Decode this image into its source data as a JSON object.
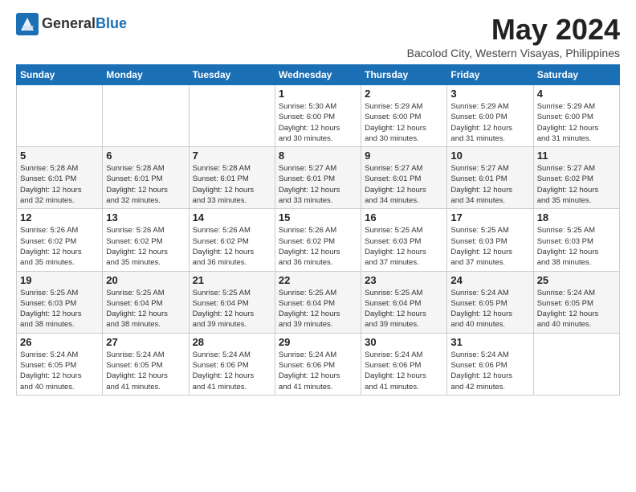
{
  "logo": {
    "general": "General",
    "blue": "Blue"
  },
  "title": "May 2024",
  "subtitle": "Bacolod City, Western Visayas, Philippines",
  "weekdays": [
    "Sunday",
    "Monday",
    "Tuesday",
    "Wednesday",
    "Thursday",
    "Friday",
    "Saturday"
  ],
  "weeks": [
    [
      {
        "day": "",
        "info": ""
      },
      {
        "day": "",
        "info": ""
      },
      {
        "day": "",
        "info": ""
      },
      {
        "day": "1",
        "info": "Sunrise: 5:30 AM\nSunset: 6:00 PM\nDaylight: 12 hours\nand 30 minutes."
      },
      {
        "day": "2",
        "info": "Sunrise: 5:29 AM\nSunset: 6:00 PM\nDaylight: 12 hours\nand 30 minutes."
      },
      {
        "day": "3",
        "info": "Sunrise: 5:29 AM\nSunset: 6:00 PM\nDaylight: 12 hours\nand 31 minutes."
      },
      {
        "day": "4",
        "info": "Sunrise: 5:29 AM\nSunset: 6:00 PM\nDaylight: 12 hours\nand 31 minutes."
      }
    ],
    [
      {
        "day": "5",
        "info": "Sunrise: 5:28 AM\nSunset: 6:01 PM\nDaylight: 12 hours\nand 32 minutes."
      },
      {
        "day": "6",
        "info": "Sunrise: 5:28 AM\nSunset: 6:01 PM\nDaylight: 12 hours\nand 32 minutes."
      },
      {
        "day": "7",
        "info": "Sunrise: 5:28 AM\nSunset: 6:01 PM\nDaylight: 12 hours\nand 33 minutes."
      },
      {
        "day": "8",
        "info": "Sunrise: 5:27 AM\nSunset: 6:01 PM\nDaylight: 12 hours\nand 33 minutes."
      },
      {
        "day": "9",
        "info": "Sunrise: 5:27 AM\nSunset: 6:01 PM\nDaylight: 12 hours\nand 34 minutes."
      },
      {
        "day": "10",
        "info": "Sunrise: 5:27 AM\nSunset: 6:01 PM\nDaylight: 12 hours\nand 34 minutes."
      },
      {
        "day": "11",
        "info": "Sunrise: 5:27 AM\nSunset: 6:02 PM\nDaylight: 12 hours\nand 35 minutes."
      }
    ],
    [
      {
        "day": "12",
        "info": "Sunrise: 5:26 AM\nSunset: 6:02 PM\nDaylight: 12 hours\nand 35 minutes."
      },
      {
        "day": "13",
        "info": "Sunrise: 5:26 AM\nSunset: 6:02 PM\nDaylight: 12 hours\nand 35 minutes."
      },
      {
        "day": "14",
        "info": "Sunrise: 5:26 AM\nSunset: 6:02 PM\nDaylight: 12 hours\nand 36 minutes."
      },
      {
        "day": "15",
        "info": "Sunrise: 5:26 AM\nSunset: 6:02 PM\nDaylight: 12 hours\nand 36 minutes."
      },
      {
        "day": "16",
        "info": "Sunrise: 5:25 AM\nSunset: 6:03 PM\nDaylight: 12 hours\nand 37 minutes."
      },
      {
        "day": "17",
        "info": "Sunrise: 5:25 AM\nSunset: 6:03 PM\nDaylight: 12 hours\nand 37 minutes."
      },
      {
        "day": "18",
        "info": "Sunrise: 5:25 AM\nSunset: 6:03 PM\nDaylight: 12 hours\nand 38 minutes."
      }
    ],
    [
      {
        "day": "19",
        "info": "Sunrise: 5:25 AM\nSunset: 6:03 PM\nDaylight: 12 hours\nand 38 minutes."
      },
      {
        "day": "20",
        "info": "Sunrise: 5:25 AM\nSunset: 6:04 PM\nDaylight: 12 hours\nand 38 minutes."
      },
      {
        "day": "21",
        "info": "Sunrise: 5:25 AM\nSunset: 6:04 PM\nDaylight: 12 hours\nand 39 minutes."
      },
      {
        "day": "22",
        "info": "Sunrise: 5:25 AM\nSunset: 6:04 PM\nDaylight: 12 hours\nand 39 minutes."
      },
      {
        "day": "23",
        "info": "Sunrise: 5:25 AM\nSunset: 6:04 PM\nDaylight: 12 hours\nand 39 minutes."
      },
      {
        "day": "24",
        "info": "Sunrise: 5:24 AM\nSunset: 6:05 PM\nDaylight: 12 hours\nand 40 minutes."
      },
      {
        "day": "25",
        "info": "Sunrise: 5:24 AM\nSunset: 6:05 PM\nDaylight: 12 hours\nand 40 minutes."
      }
    ],
    [
      {
        "day": "26",
        "info": "Sunrise: 5:24 AM\nSunset: 6:05 PM\nDaylight: 12 hours\nand 40 minutes."
      },
      {
        "day": "27",
        "info": "Sunrise: 5:24 AM\nSunset: 6:05 PM\nDaylight: 12 hours\nand 41 minutes."
      },
      {
        "day": "28",
        "info": "Sunrise: 5:24 AM\nSunset: 6:06 PM\nDaylight: 12 hours\nand 41 minutes."
      },
      {
        "day": "29",
        "info": "Sunrise: 5:24 AM\nSunset: 6:06 PM\nDaylight: 12 hours\nand 41 minutes."
      },
      {
        "day": "30",
        "info": "Sunrise: 5:24 AM\nSunset: 6:06 PM\nDaylight: 12 hours\nand 41 minutes."
      },
      {
        "day": "31",
        "info": "Sunrise: 5:24 AM\nSunset: 6:06 PM\nDaylight: 12 hours\nand 42 minutes."
      },
      {
        "day": "",
        "info": ""
      }
    ]
  ]
}
